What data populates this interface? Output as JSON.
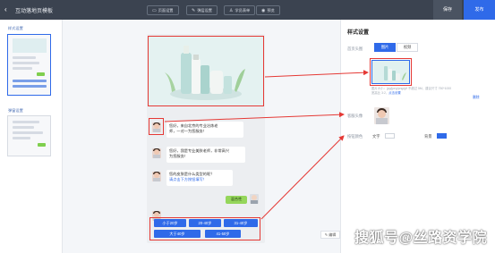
{
  "app": {
    "back_glyph": "‹",
    "title": "互动落地页模板"
  },
  "toolbar": {
    "items": [
      {
        "icon": "monitor-icon",
        "label": "页面设置"
      },
      {
        "icon": "pencil-icon",
        "label": "弹层设置"
      },
      {
        "icon": "user-icon",
        "label": "学员表单"
      },
      {
        "icon": "eye-icon",
        "label": "预览"
      }
    ],
    "save_label": "保存",
    "publish_label": "发布"
  },
  "left_panel": {
    "section1": "样式设置",
    "section2": "弹窗设置"
  },
  "chat": {
    "messages": [
      {
        "line1": "您好，来自北京的专业冶炼老",
        "line2": "师，一对一为您服务！"
      },
      {
        "line1": "您好，我是专业美肤老师，非常高兴",
        "line2": "为您服务！"
      },
      {
        "line1": "您的皮肤是什么类型的呢？",
        "line2": "请点击下方按钮填写！"
      }
    ],
    "reply": "混合性",
    "options_row1": [
      "小于20岁",
      "20-40岁",
      "31-40岁"
    ],
    "options_row2": [
      "大于40岁",
      "41-50岁"
    ],
    "edit_label": "编辑"
  },
  "right_panel": {
    "title": "样式设置",
    "header_label": "首页头图",
    "tab_image": "图片",
    "tab_video": "视频",
    "note_line1": "图片大小：jpg/jpeg/png/gif 不超过 5M，建议尺寸 750*1000",
    "note_line2": "宽高比 3:2，",
    "note_link": "点击设置",
    "note_delete": "删除",
    "avatar_label": "客服头像",
    "color_label": "按钮颜色",
    "text_label": "文字",
    "bg_label": "背景",
    "text_color": "#ffffff",
    "bg_color": "#2f6ae9"
  },
  "watermark": "搜狐号@丝路资学院",
  "colors": {
    "topbar": "#3b4350",
    "accent": "#2f6ae9",
    "highlight": "#e53935",
    "reply_green": "#95d65b"
  }
}
